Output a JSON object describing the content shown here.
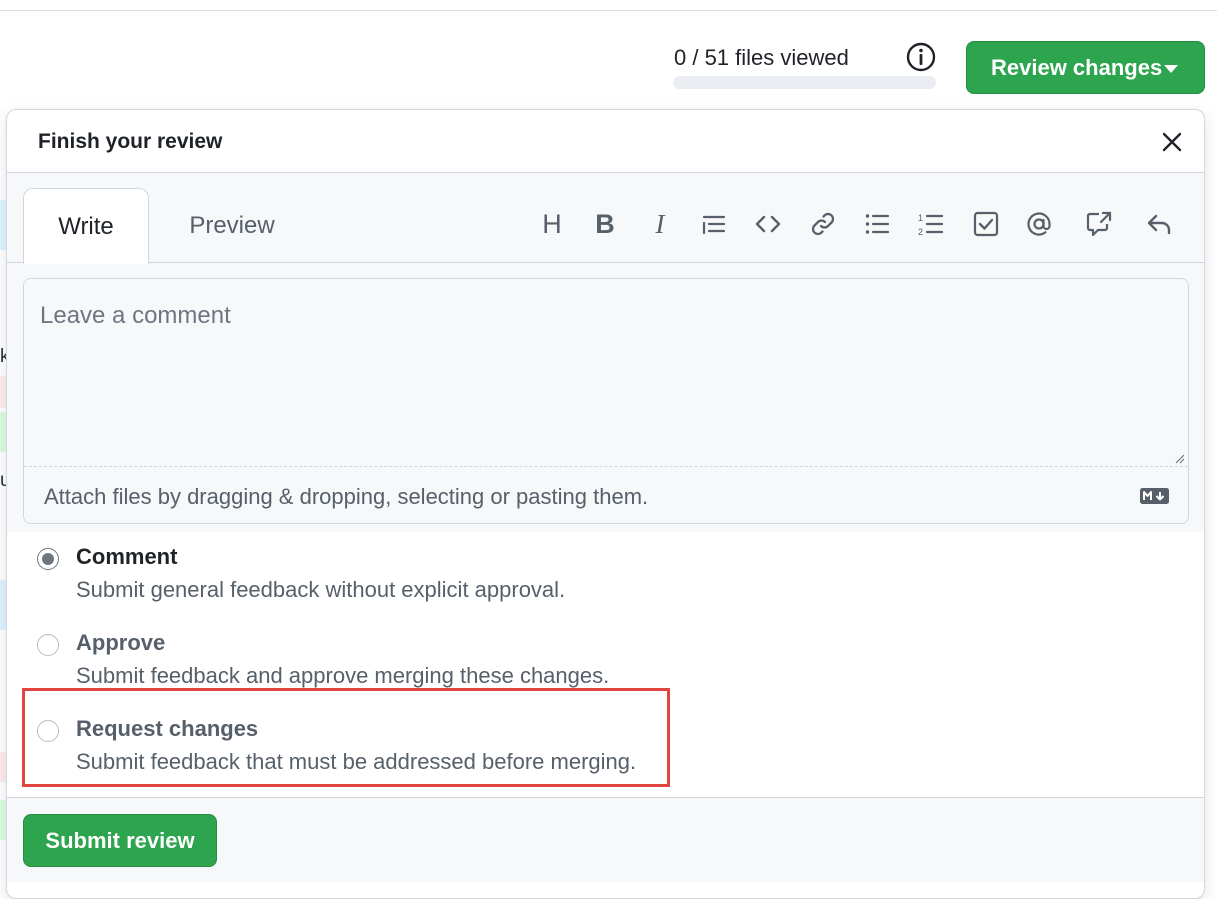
{
  "header": {
    "files_viewed": "0 / 51 files viewed",
    "files_viewed_progress": 0,
    "review_button": "Review changes"
  },
  "panel": {
    "title": "Finish your review",
    "tabs": [
      {
        "label": "Write",
        "active": true
      },
      {
        "label": "Preview",
        "active": false
      }
    ],
    "toolbar": [
      {
        "name": "heading",
        "icon": "heading-icon",
        "glyph": "H"
      },
      {
        "name": "bold",
        "icon": "bold-icon",
        "glyph": "B"
      },
      {
        "name": "italic",
        "icon": "italic-icon",
        "glyph": "I"
      },
      {
        "name": "quote",
        "icon": "quote-icon"
      },
      {
        "name": "code",
        "icon": "code-icon"
      },
      {
        "name": "link",
        "icon": "link-icon"
      },
      {
        "name": "unordered-list",
        "icon": "unordered-list-icon"
      },
      {
        "name": "ordered-list",
        "icon": "ordered-list-icon"
      },
      {
        "name": "task-list",
        "icon": "task-list-icon"
      },
      {
        "name": "mention",
        "icon": "mention-icon"
      },
      {
        "name": "cross-reference",
        "icon": "cross-reference-icon"
      },
      {
        "name": "saved-replies",
        "icon": "reply-icon"
      }
    ],
    "comment_placeholder": "Leave a comment",
    "attach_text": "Attach files by dragging & dropping, selecting or pasting them.",
    "markdown_icon": "markdown-icon",
    "options": [
      {
        "label": "Comment",
        "description": "Submit general feedback without explicit approval.",
        "checked": true
      },
      {
        "label": "Approve",
        "description": "Submit feedback and approve merging these changes.",
        "checked": false
      },
      {
        "label": "Request changes",
        "description": "Submit feedback that must be addressed before merging.",
        "checked": false
      }
    ],
    "submit_button": "Submit review"
  },
  "background_fragments": [
    "k",
    "u"
  ],
  "colors": {
    "primary_green": "#2da44e",
    "highlight_red": "#e0463f",
    "border": "#d0d7de",
    "muted_text": "#57606a"
  }
}
